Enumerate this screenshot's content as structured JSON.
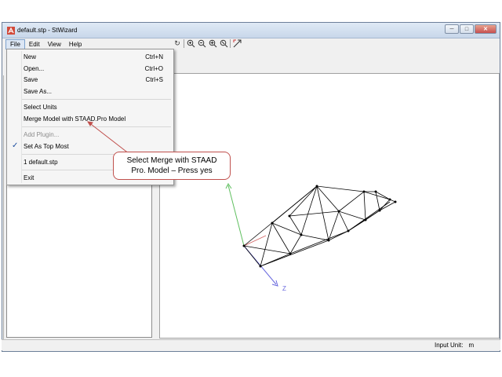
{
  "window": {
    "title": "default.stp - StWizard",
    "controls": {
      "minimize": "─",
      "maximize": "□",
      "close": "✕"
    }
  },
  "menubar": {
    "items": [
      "File",
      "Edit",
      "View",
      "Help"
    ],
    "active": "File"
  },
  "file_menu": {
    "items": [
      {
        "label": "New",
        "shortcut": "Ctrl+N"
      },
      {
        "label": "Open...",
        "shortcut": "Ctrl+O"
      },
      {
        "label": "Save",
        "shortcut": "Ctrl+S"
      },
      {
        "label": "Save As...",
        "shortcut": ""
      },
      {
        "label": "Select Units",
        "shortcut": ""
      },
      {
        "label": "Merge Model with STAAD.Pro Model",
        "shortcut": ""
      },
      {
        "label": "Add Plugin...",
        "shortcut": "",
        "disabled": true
      },
      {
        "label": "Set As Top Most",
        "shortcut": "",
        "checked": true
      },
      {
        "label": "1 default.stp",
        "shortcut": ""
      },
      {
        "label": "Exit",
        "shortcut": ""
      }
    ]
  },
  "toolbar": {
    "icons": [
      "rotate-icon",
      "zoom-in-icon",
      "zoom-out-icon",
      "zoom-window-icon",
      "zoom-fit-icon",
      "pan-icon"
    ]
  },
  "callout": {
    "line1": "Select Merge with STAAD",
    "line2": "Pro.  Model – Press yes"
  },
  "viewport": {
    "axis_z_label": "Z"
  },
  "statusbar": {
    "input_unit_label": "Input Unit:",
    "input_unit_value": "m"
  },
  "colors": {
    "callout_border": "#c0504d",
    "axis_y": "#5fbf5f",
    "axis_z": "#6a6adf",
    "model_lines": "#000000"
  }
}
